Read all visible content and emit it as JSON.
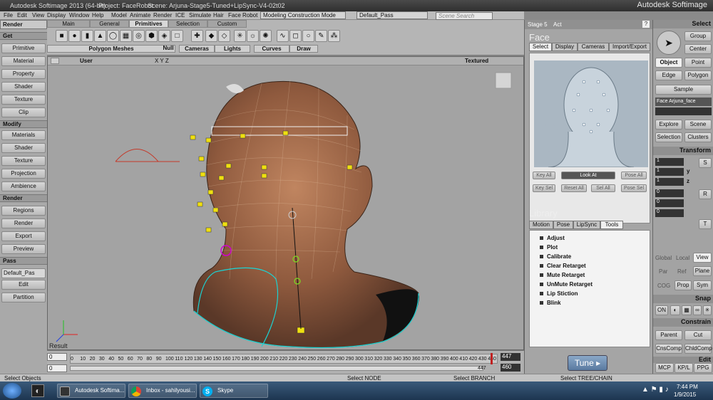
{
  "titlebar": {
    "app": "Autodesk Softimage 2013 (64-bit)",
    "project": "Project: FaceRobot",
    "scene": "Scene: Arjuna-Stage5-Tuned+LipSync-V4-02t02",
    "brand": "Autodesk Softimage"
  },
  "menu": [
    "File",
    "Edit",
    "View",
    "Display",
    "Window",
    "Help",
    "Model",
    "Animate",
    "Render",
    "ICE",
    "Simulate",
    "Hair",
    "Face Robot"
  ],
  "mode": "Modeling Construction Mode",
  "pass": "Default_Pass",
  "search_placeholder": "Scene Search",
  "left": {
    "top": "Render",
    "sections": [
      {
        "title": "Get",
        "items": [
          "Primitive",
          "Material",
          "Property",
          "Shader",
          "Texture",
          "Clip"
        ]
      },
      {
        "title": "Modify",
        "items": [
          "Materials",
          "Shader",
          "Texture",
          "Projection",
          "Ambience"
        ]
      },
      {
        "title": "Render",
        "items": [
          "Regions",
          "Render",
          "Export",
          "Preview"
        ]
      },
      {
        "title": "Pass",
        "items": [
          "Default_Pas",
          "Edit",
          "Partition"
        ]
      }
    ]
  },
  "shelf": {
    "tabs": [
      "Main",
      "General",
      "Primitives",
      "Selection",
      "Custom"
    ],
    "active_tab": "Primitives",
    "groups": [
      "Polygon Meshes",
      "Null",
      "Cameras",
      "Lights",
      "Curves",
      "Draw"
    ]
  },
  "viewport": {
    "camera": "User",
    "view_mode": "Textured",
    "axes": "X Y Z",
    "result_label": "Result"
  },
  "timeline": {
    "ticks": [
      "0",
      "10",
      "20",
      "30",
      "40",
      "50",
      "60",
      "70",
      "80",
      "90",
      "100",
      "110",
      "120",
      "130",
      "140",
      "150",
      "160",
      "170",
      "180",
      "190",
      "200",
      "210",
      "220",
      "230",
      "240",
      "250",
      "260",
      "270",
      "280",
      "290",
      "300",
      "310",
      "320",
      "330",
      "340",
      "350",
      "360",
      "370",
      "380",
      "390",
      "400",
      "410",
      "420",
      "430",
      "440"
    ],
    "start": "0",
    "start2": "0",
    "current": "447",
    "end": "447",
    "end_range": "460"
  },
  "status": {
    "left": "Select Objects",
    "node": "Select NODE",
    "branch": "Select BRANCH",
    "tree": "Select TREE/CHAIN"
  },
  "facerobot": {
    "stage": "Stage 5",
    "act": "Act",
    "face_title": "Face",
    "face_tabs": [
      "Select",
      "Display",
      "Cameras",
      "Import/Export"
    ],
    "buttons_row1": [
      "Key All",
      "Look At",
      "Pose All"
    ],
    "buttons_row2": [
      "Key Sel",
      "Reset All",
      "Sel All",
      "Pose Sel"
    ],
    "library_title": "Library",
    "lib_tabs": [
      "Motion",
      "Pose",
      "LipSync",
      "Tools"
    ],
    "tools": [
      "Adjust",
      "Plot",
      "Calibrate",
      "Clear Retarget",
      "Mute Retarget",
      "UnMute Retarget",
      "Lip Stiction",
      "Blink"
    ],
    "tune": "Tune"
  },
  "right": {
    "select": "Select",
    "group": "Group",
    "center": "Center",
    "object": "Object",
    "point": "Point",
    "edge": "Edge",
    "polygon": "Polygon",
    "sample": "Sample",
    "name_field": "Face Arjuna_face",
    "explore": "Explore",
    "scene": "Scene",
    "selection": "Selection",
    "clusters": "Clusters",
    "transform": "Transform",
    "t_vals": [
      "1",
      "1",
      "1",
      "0",
      "0",
      "0",
      "0",
      "0",
      "0"
    ],
    "axes": [
      "x",
      "y",
      "z"
    ],
    "srt": [
      "S",
      "R",
      "T"
    ],
    "global": "Global",
    "local": "Local",
    "view": "View",
    "par": "Par",
    "ref": "Ref",
    "plane": "Plane",
    "cog": "COG",
    "prop": "Prop",
    "sym": "Sym",
    "snap": "Snap",
    "on": "ON",
    "constrain": "Constrain",
    "parent": "Parent",
    "cut": "Cut",
    "cnscomp": "CnsComp",
    "chldcomp": "ChldComp",
    "edit": "Edit",
    "mcp": "MCP",
    "kpl": "KP/L",
    "ppg": "PPG"
  },
  "taskbar": {
    "apps": [
      "Autodesk Softima...",
      "Inbox - sahilyousi...",
      "Skype"
    ],
    "time": "7:44 PM",
    "date": "1/9/2015"
  }
}
